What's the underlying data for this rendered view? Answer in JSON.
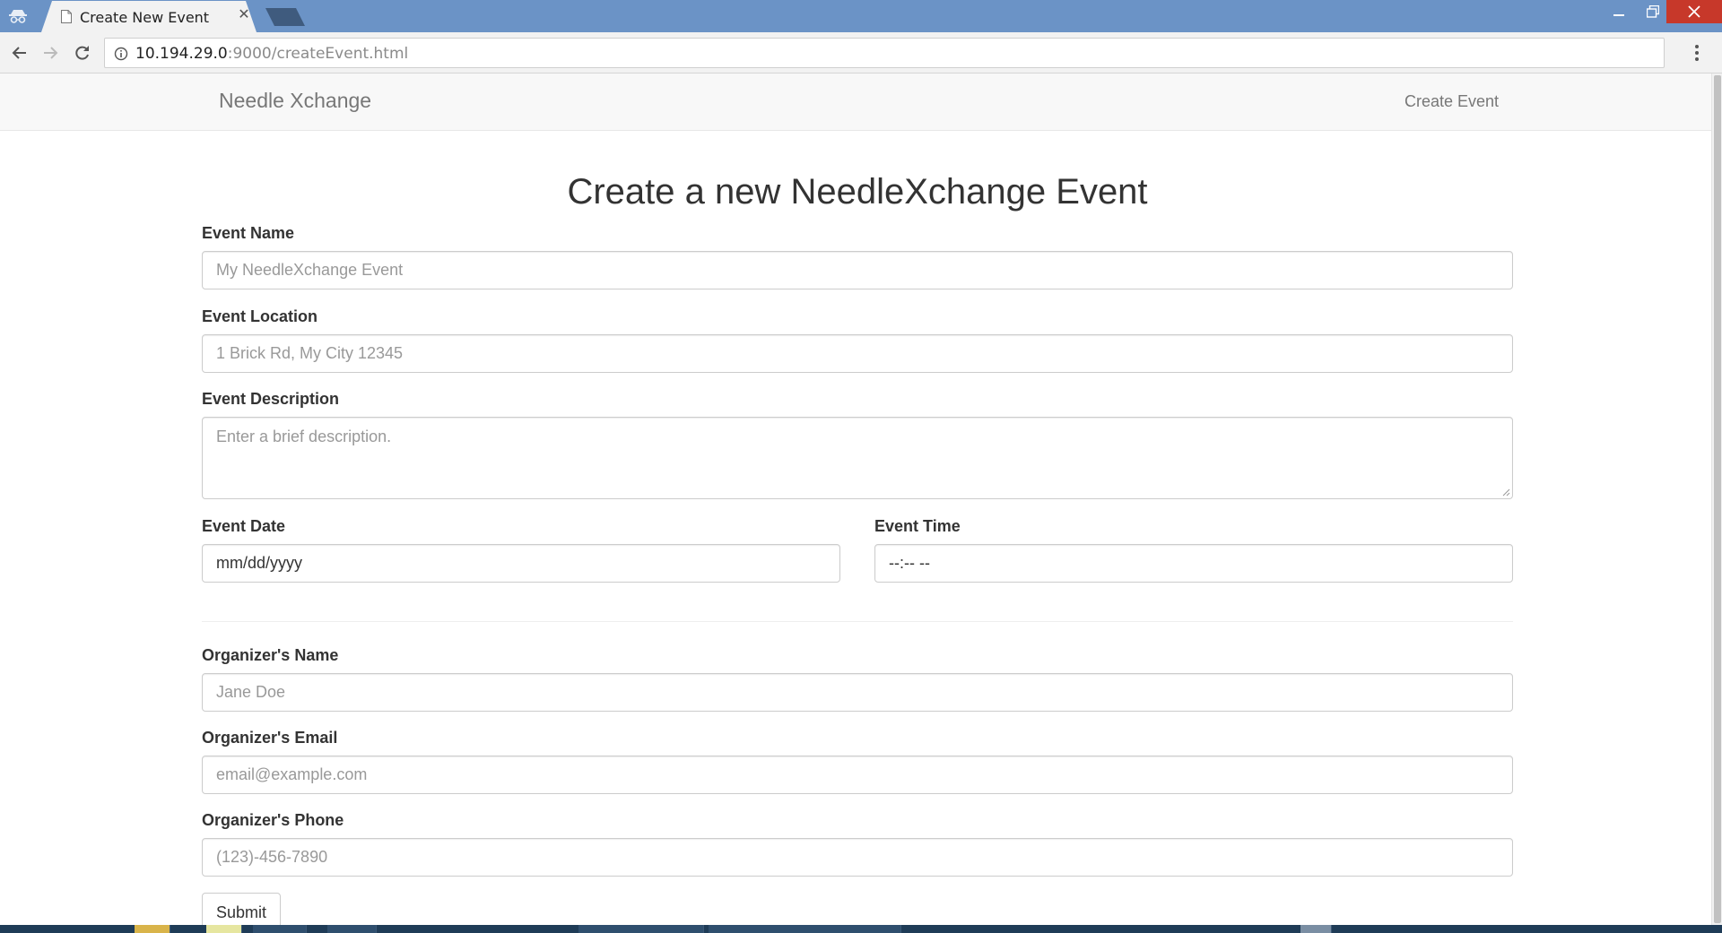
{
  "browser": {
    "tab_title": "Create New Event",
    "url_host": "10.194.29.0",
    "url_rest": ":9000/createEvent.html"
  },
  "navbar": {
    "brand": "Needle Xchange",
    "link": "Create Event"
  },
  "form": {
    "title": "Create a new NeedleXchange Event",
    "event_name": {
      "label": "Event Name",
      "placeholder": "My NeedleXchange Event"
    },
    "event_location": {
      "label": "Event Location",
      "placeholder": "1 Brick Rd, My City 12345"
    },
    "event_description": {
      "label": "Event Description",
      "placeholder": "Enter a brief description."
    },
    "event_date": {
      "label": "Event Date",
      "value": "mm/dd/yyyy"
    },
    "event_time": {
      "label": "Event Time",
      "value": "--:-- --"
    },
    "organizer_name": {
      "label": "Organizer's Name",
      "placeholder": "Jane Doe"
    },
    "organizer_email": {
      "label": "Organizer's Email",
      "placeholder": "email@example.com"
    },
    "organizer_phone": {
      "label": "Organizer's Phone",
      "placeholder": "(123)-456-7890"
    },
    "submit_label": "Submit"
  },
  "colors": {
    "tabstrip": "#6b93c6",
    "navbar_bg": "#f8f8f8",
    "close_button": "#c7382a"
  }
}
